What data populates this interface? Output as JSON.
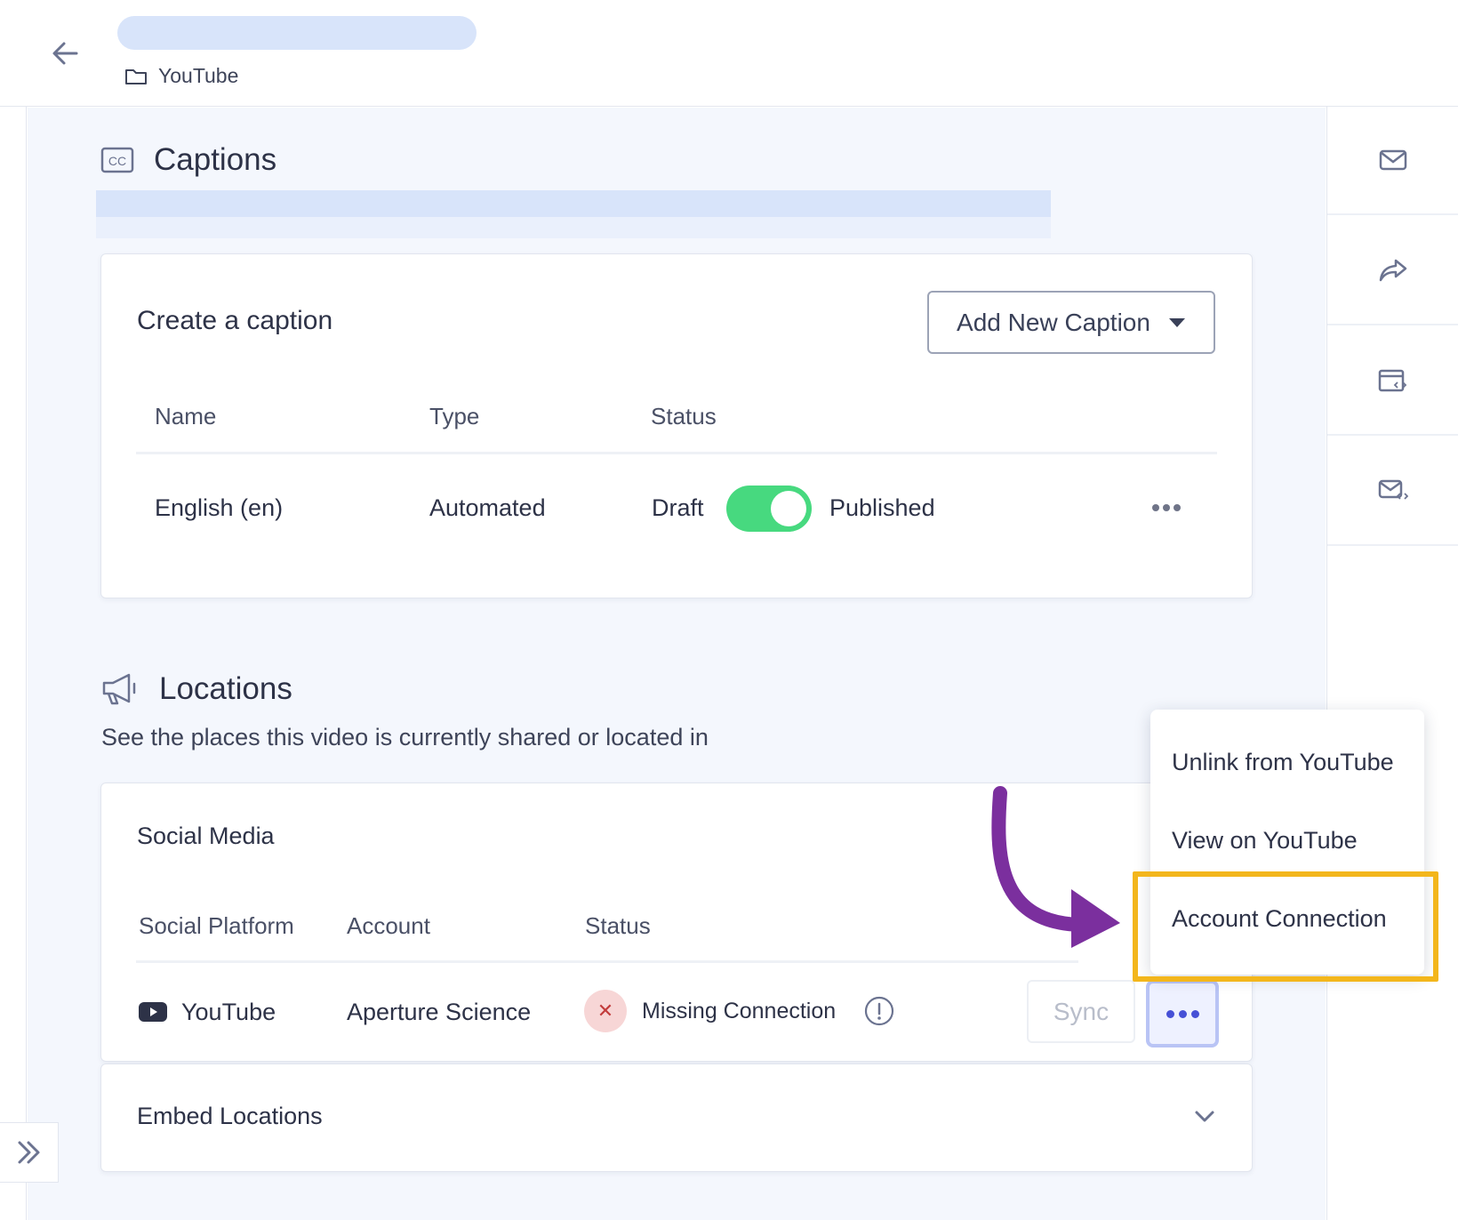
{
  "header": {
    "breadcrumb_folder": "YouTube"
  },
  "captions": {
    "title": "Captions",
    "card_title": "Create a caption",
    "add_button_label": "Add New Caption",
    "columns": {
      "name": "Name",
      "type": "Type",
      "status": "Status"
    },
    "row": {
      "name": "English (en)",
      "type": "Automated",
      "status_off": "Draft",
      "status_on": "Published",
      "published": true
    }
  },
  "locations": {
    "title": "Locations",
    "subtitle": "See the places this video is currently shared or located in",
    "social_media": {
      "title": "Social Media",
      "columns": {
        "platform": "Social Platform",
        "account": "Account",
        "status": "Status"
      },
      "row": {
        "platform": "YouTube",
        "account": "Aperture Science",
        "status": "Missing Connection",
        "sync_label": "Sync"
      }
    },
    "embed_title": "Embed Locations"
  },
  "context_menu": {
    "items": [
      "Unlink from YouTube",
      "View on YouTube",
      "Account Connection"
    ]
  },
  "colors": {
    "accent": "#4650d6",
    "toggle_on": "#47d97f",
    "highlight": "#f3b61c",
    "annotation_arrow": "#7b2f9e",
    "error": "#c23b3b"
  },
  "icons": {
    "back": "arrow-left-icon",
    "folder": "folder-icon",
    "captions": "closed-captions-icon",
    "locations": "megaphone-icon",
    "rail": [
      "mail-icon",
      "share-icon",
      "embed-window-icon",
      "email-embed-icon"
    ],
    "expand": "double-chevron-right-icon",
    "youtube": "youtube-icon",
    "error": "x-icon",
    "info": "exclamation-circle-icon",
    "embed_toggle": "chevron-down-icon"
  }
}
